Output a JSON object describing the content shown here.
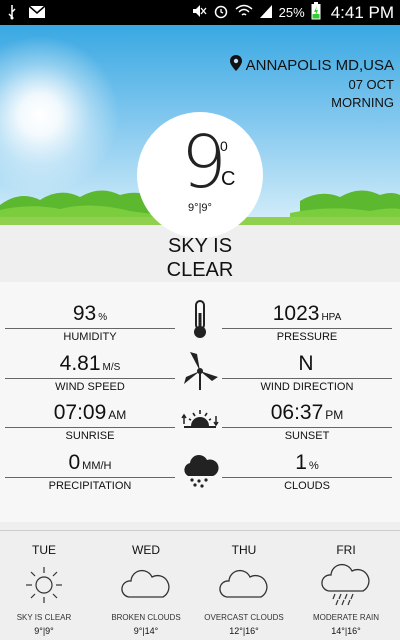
{
  "status_bar": {
    "battery": "25%",
    "time": "4:41 PM"
  },
  "location": {
    "city": "ANNAPOLIS MD,USA",
    "date": "07 OCT",
    "period": "MORNING"
  },
  "current": {
    "temp": "9",
    "degree": "0",
    "unit": "C",
    "range": "9°|9°",
    "condition_line1": "SKY IS",
    "condition_line2": "CLEAR"
  },
  "stats": {
    "humidity": {
      "value": "93",
      "unit": "%",
      "label": "HUMIDITY"
    },
    "pressure": {
      "value": "1023",
      "unit": "HPA",
      "label": "PRESSURE"
    },
    "wind_speed": {
      "value": "4.81",
      "unit": "M/S",
      "label": "WIND SPEED"
    },
    "wind_direction": {
      "value": "N",
      "unit": "",
      "label": "WIND DIRECTION"
    },
    "sunrise": {
      "value": "07:09",
      "unit": "AM",
      "label": "SUNRISE"
    },
    "sunset": {
      "value": "06:37",
      "unit": "PM",
      "label": "SUNSET"
    },
    "precipitation": {
      "value": "0",
      "unit": "MM/H",
      "label": "PRECIPITATION"
    },
    "clouds": {
      "value": "1",
      "unit": "%",
      "label": "CLOUDS"
    }
  },
  "forecast": [
    {
      "day": "TUE",
      "icon": "sun-icon",
      "desc": "SKY IS CLEAR",
      "range": "9°|9°"
    },
    {
      "day": "WED",
      "icon": "cloud-icon",
      "desc": "BROKEN CLOUDS",
      "range": "9°|14°"
    },
    {
      "day": "THU",
      "icon": "cloud-icon",
      "desc": "OVERCAST CLOUDS",
      "range": "12°|16°"
    },
    {
      "day": "FRI",
      "icon": "rain-cloud-icon",
      "desc": "MODERATE RAIN",
      "range": "14°|16°"
    }
  ],
  "colors": {
    "sky_top": "#39a8e2",
    "sky_bottom": "#d6eefa",
    "grass": "#5cb82f",
    "panel_bg": "#f7f7f7"
  }
}
